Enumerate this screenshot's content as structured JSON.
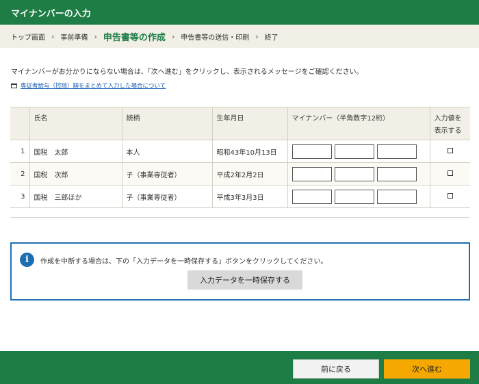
{
  "title": "マイナンバーの入力",
  "breadcrumb": {
    "items": [
      "トップ画面",
      "事前準備",
      "申告書等の作成",
      "申告書等の送信・印刷",
      "終了"
    ],
    "current_index": 2,
    "separator": "›"
  },
  "intro": "マイナンバーがお分かりにならない場合は、「次へ進む」をクリックし、表示されるメッセージをご確認ください。",
  "help_link": "専従者給与（控除）額をまとめて入力した場合について",
  "table": {
    "headers": {
      "no": "",
      "name": "氏名",
      "relation": "続柄",
      "birth": "生年月日",
      "mynumber": "マイナンバー（半角数字12桁）",
      "show_line1": "入力値を",
      "show_line2": "表示する"
    },
    "rows": [
      {
        "no": "1",
        "name": "国税　太郎",
        "relation": "本人",
        "birth": "昭和43年10月13日"
      },
      {
        "no": "2",
        "name": "国税　次郎",
        "relation": "子（事業専従者）",
        "birth": "平成2年2月2日"
      },
      {
        "no": "3",
        "name": "国税　三郎ほか",
        "relation": "子（事業専従者）",
        "birth": "平成3年3月3日"
      }
    ]
  },
  "notice": {
    "icon": "info-icon",
    "text": "作成を中断する場合は、下の「入力データを一時保存する」ボタンをクリックしてください。",
    "save_button": "入力データを一時保存する"
  },
  "footer": {
    "back_button": "前に戻る",
    "next_button": "次へ進む"
  },
  "colors": {
    "brand_green": "#1e7d45",
    "breadcrumb_bg": "#f1efe6",
    "info_blue": "#1f6fb0",
    "next_orange": "#f5a800"
  }
}
